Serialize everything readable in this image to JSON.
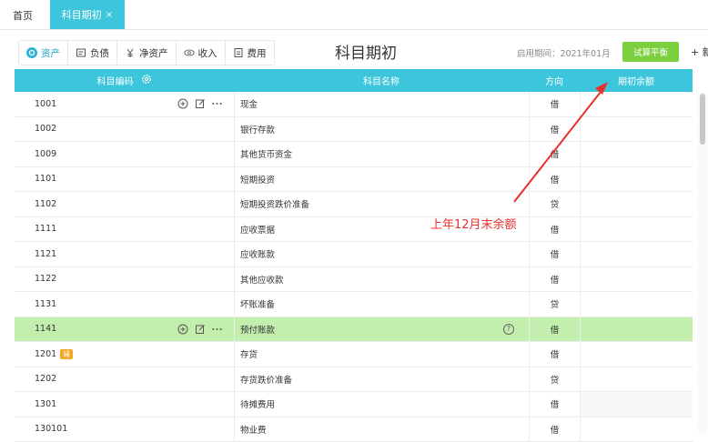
{
  "topbar": {
    "home_tab": "首页",
    "active_tab": "科目期初",
    "close_glyph": "×"
  },
  "toolbar": {
    "categories": [
      {
        "label": "资产",
        "icon": "asset-icon",
        "active": true
      },
      {
        "label": "负债",
        "icon": "liability-icon",
        "active": false
      },
      {
        "label": "净资产",
        "icon": "net-asset-icon",
        "active": false
      },
      {
        "label": "收入",
        "icon": "income-icon",
        "active": false
      },
      {
        "label": "费用",
        "icon": "expense-icon",
        "active": false
      }
    ],
    "title": "科目期初",
    "period_label": "启用期间：2021年01月",
    "trial_balance_button": "试算平衡",
    "new_button": "+ 新"
  },
  "table": {
    "headers": {
      "code": "科目编码",
      "name": "科目名称",
      "direction": "方向",
      "balance": "期初余额"
    },
    "rows": [
      {
        "code": "1001",
        "name": "现金",
        "direction": "借",
        "actions": true
      },
      {
        "code": "1002",
        "name": "银行存款",
        "direction": "借"
      },
      {
        "code": "1009",
        "name": "其他货币资金",
        "direction": "借"
      },
      {
        "code": "1101",
        "name": "短期投资",
        "direction": "借"
      },
      {
        "code": "1102",
        "name": "短期投资跌价准备",
        "direction": "贷"
      },
      {
        "code": "1111",
        "name": "应收票据",
        "direction": "借"
      },
      {
        "code": "1121",
        "name": "应收账款",
        "direction": "借"
      },
      {
        "code": "1122",
        "name": "其他应收款",
        "direction": "借"
      },
      {
        "code": "1131",
        "name": "坏账准备",
        "direction": "贷"
      },
      {
        "code": "1141",
        "name": "预付账款",
        "direction": "借",
        "actions": true,
        "highlight": true,
        "help": true
      },
      {
        "code": "1201",
        "name": "存货",
        "direction": "借",
        "badge": "辅"
      },
      {
        "code": "1202",
        "name": "存货跌价准备",
        "direction": "贷"
      },
      {
        "code": "1301",
        "name": "待摊费用",
        "direction": "借",
        "shaded": true
      },
      {
        "code": "130101",
        "name": "物业费",
        "direction": "借"
      }
    ]
  },
  "annotation": {
    "text": "上年12月末余额",
    "color": "#e8302b"
  },
  "colors": {
    "accent": "#3dc5dc",
    "highlight_row": "#c2efae",
    "trial_button": "#7bcf3f",
    "badge": "#f5a623"
  }
}
